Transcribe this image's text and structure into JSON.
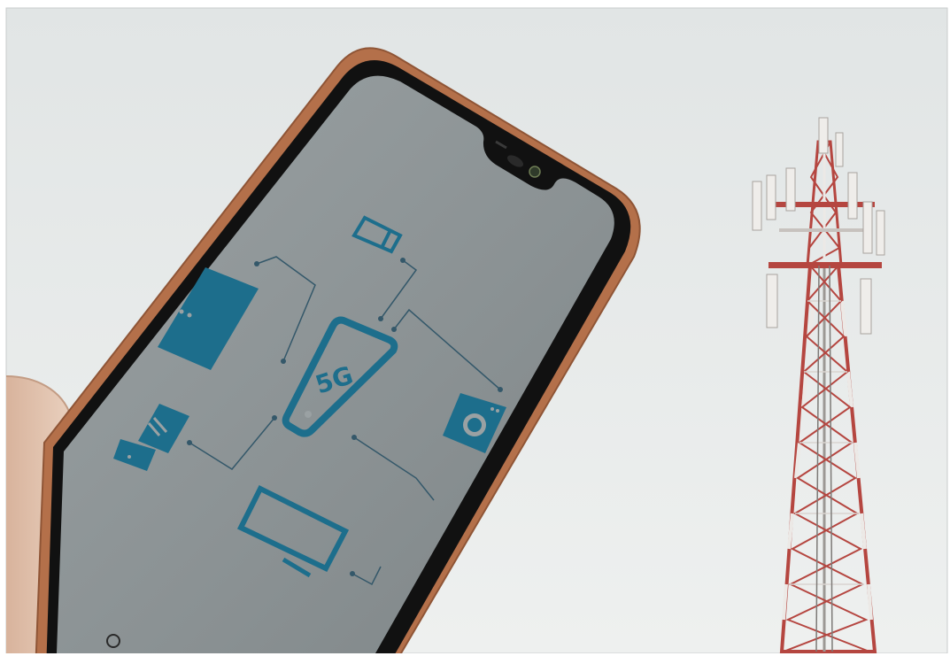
{
  "photo": {
    "phone_screen_label": "5G",
    "colors": {
      "sky": "#e9eceb",
      "phone_frame": "#b4704a",
      "bezel": "#111111",
      "screen": "#8e9597",
      "icon": "#1d6e8c",
      "tower_red": "#b54640",
      "tower_white": "#ece9e6",
      "skin": "#e4c8b3"
    }
  }
}
